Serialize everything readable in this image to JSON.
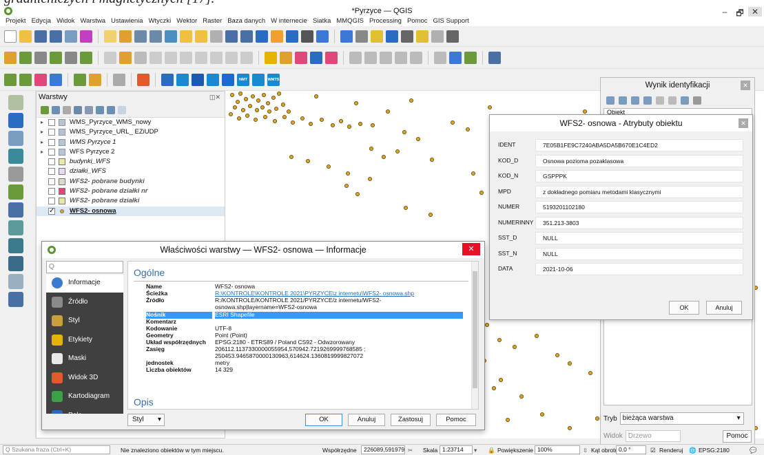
{
  "caption": "gradnieniczych i magnetycznych [17].",
  "window": {
    "title": "*Pyrzyce — QGIS",
    "minimize": "–",
    "maximize": "🗗",
    "close": "✕"
  },
  "menu": [
    "Projekt",
    "Edycja",
    "Widok",
    "Warstwa",
    "Ustawienia",
    "Wtyczki",
    "Wektor",
    "Raster",
    "Baza danych",
    "W internecie",
    "Siatka",
    "MMQGIS",
    "Processing",
    "Pomoc",
    "GIS Support"
  ],
  "toolbar_labels": {
    "nmt": "NMT",
    "wmts": "WMTS"
  },
  "layers_panel": {
    "title": "Warstwy",
    "items": [
      {
        "name": "WMS_Pyrzyce_WMS_nowy",
        "checked": false,
        "style": "normal",
        "color": ""
      },
      {
        "name": "WMS_Pyrzyce_URL_ EZiUDP",
        "checked": false,
        "style": "normal",
        "color": ""
      },
      {
        "name": "WMS Pyrzyce 1",
        "checked": false,
        "style": "italic",
        "color": ""
      },
      {
        "name": "WFS Pyrzyce 2",
        "checked": false,
        "style": "normal",
        "color": ""
      },
      {
        "name": "budynki_WFS",
        "checked": false,
        "style": "italic",
        "color": "#e8e6a8"
      },
      {
        "name": "działki_WFS",
        "checked": false,
        "style": "italic",
        "color": "#e9d9ef"
      },
      {
        "name": "WFS2- pobrane budynki",
        "checked": false,
        "style": "italic-bold",
        "color": "#dcd7c8"
      },
      {
        "name": "WFS2- pobrane działki nr",
        "checked": false,
        "style": "italic-bold",
        "color": "#e0487a"
      },
      {
        "name": "WFS2- pobrane działki",
        "checked": false,
        "style": "italic-bold",
        "color": "#e8e6a8"
      },
      {
        "name": "WFS2- osnowa",
        "checked": true,
        "style": "bold-underline",
        "color": "#e0a020"
      }
    ]
  },
  "identify_panel": {
    "title": "Wynik identyfikacji",
    "tree_header": "Obiekt",
    "mode_label": "Tryb",
    "mode_value": "bieżąca warstwa",
    "view_label": "Widok",
    "view_value": "Drzewo",
    "help_label": "Pomoc"
  },
  "attr_dialog": {
    "title": "WFS2- osnowa - Atrybuty obiektu",
    "rows": [
      {
        "key": "IDENT",
        "value": "7E05B1FE9C7240ABA5DA5B670E1C4ED2"
      },
      {
        "key": "KOD_D",
        "value": "Osnowa pozioma pozaklasowa"
      },
      {
        "key": "KOD_N",
        "value": "GSPPPK"
      },
      {
        "key": "MPD",
        "value": "z dokładnego pomiaru metodami klasycznymi"
      },
      {
        "key": "NUMER",
        "value": "5193201102180"
      },
      {
        "key": "NUMERINNY",
        "value": "351.213-3803"
      },
      {
        "key": "SST_D",
        "value": "NULL"
      },
      {
        "key": "SST_N",
        "value": "NULL"
      },
      {
        "key": "DATA",
        "value": "2021-10-06"
      }
    ],
    "ok_label": "OK",
    "cancel_label": "Anuluj"
  },
  "props_dialog": {
    "title": "Właściwości warstwy — WFS2- osnowa — Informacje",
    "search_placeholder": "Q",
    "nav": [
      {
        "label": "Informacje",
        "icon": "info-icon",
        "color": "#3a7ad6",
        "active": true
      },
      {
        "label": "Źródło",
        "icon": "source-icon",
        "color": "#8a8a8a",
        "active": false
      },
      {
        "label": "Styl",
        "icon": "style-icon",
        "color": "#c9a03a",
        "active": false
      },
      {
        "label": "Etykiety",
        "icon": "labels-icon",
        "color": "#e6b400",
        "active": false
      },
      {
        "label": "Maski",
        "icon": "masks-icon",
        "color": "#e8e8e8",
        "active": false
      },
      {
        "label": "Widok 3D",
        "icon": "view3d-icon",
        "color": "#e05a2a",
        "active": false
      },
      {
        "label": "Kartodiagram",
        "icon": "diagram-icon",
        "color": "#3aa04a",
        "active": false
      },
      {
        "label": "Pola",
        "icon": "fields-icon",
        "color": "#2a6cc0",
        "active": false
      }
    ],
    "section_general": "Ogólne",
    "section_desc": "Opis",
    "info": [
      {
        "key": "Name",
        "value": "WFS2- osnowa",
        "link": false,
        "hl": false
      },
      {
        "key": "Ścieżka",
        "value": "R:\\KONTROLE\\KONTROLE 2021\\PYRZYCE\\z internetu\\WFS2- osnowa.shp",
        "link": true,
        "hl": false
      },
      {
        "key": "Źródło",
        "value": "R:/KONTROLE/KONTROLE 2021/PYRZYCE/z internetu/WFS2- osnowa.shp|layername=WFS2-osnowa",
        "link": false,
        "hl": false
      },
      {
        "key": "Nośnik",
        "value": "ESRI Shapefile",
        "link": false,
        "hl": true
      },
      {
        "key": "Komentarz",
        "value": "",
        "link": false,
        "hl": false
      },
      {
        "key": "Kodowanie",
        "value": "UTF-8",
        "link": false,
        "hl": false
      },
      {
        "key": "Geometry",
        "value": "Point (Point)",
        "link": false,
        "hl": false
      },
      {
        "key": "Układ współrzędnych",
        "value": "EPSG:2180 - ETRS89 / Poland CS92 - Odwzorowany",
        "link": false,
        "hl": false
      },
      {
        "key": "Zasięg",
        "value": "206112.1137330000055954,570942.7219269999768585 : 250453.9465870000130963,614624.1360819999827072",
        "link": false,
        "hl": false
      },
      {
        "key": "jednostek",
        "value": "metry",
        "link": false,
        "hl": false
      },
      {
        "key": "Liczba obiektów",
        "value": "14 329",
        "link": false,
        "hl": false
      }
    ],
    "style_label": "Styl",
    "ok_label": "OK",
    "cancel_label": "Anuluj",
    "apply_label": "Zastosuj",
    "help_label": "Pomoc"
  },
  "statusbar": {
    "search_placeholder": "Q  Szukana fraza (Ctrl+K)",
    "message": "Nie znaleziono obiektów w tym miejscu.",
    "coord_label": "Współrzędne",
    "coord_value": "226089,591979",
    "scale_label": "Skala",
    "scale_value": "1:23714",
    "zoom_label": "Powiększenie",
    "zoom_value": "100%",
    "rotation_label": "Kąt obrotu",
    "rotation_value": "0,0 °",
    "render_label": "Renderuj",
    "crs_label": "EPSG:2180"
  },
  "colors": {
    "point_fill": "#e0a020",
    "point_stroke": "#5a4a10",
    "accent": "#3a8ee6",
    "qgis_green": "#589632"
  }
}
